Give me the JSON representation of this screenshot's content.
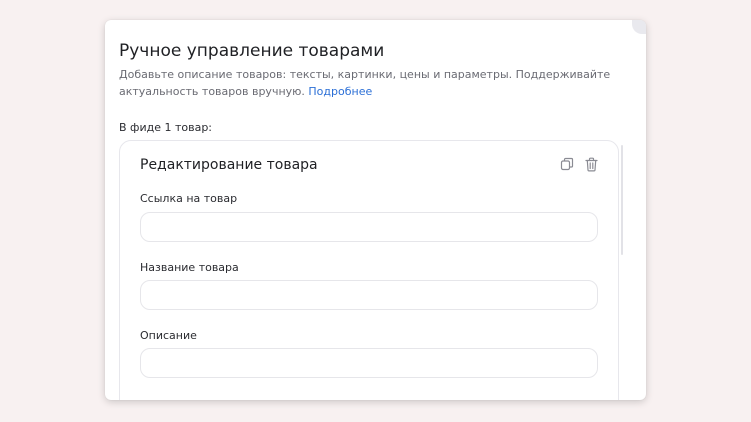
{
  "modal": {
    "title": "Ручное управление товарами",
    "description": "Добавьте описание товаров: тексты, картинки, цены и параметры. Поддерживайте актуальность товаров вручную.",
    "link_label": "Подробнее",
    "feed_count": "В фиде 1 товар:"
  },
  "card": {
    "title": "Редактирование товара",
    "icons": {
      "copy": "copy-icon",
      "delete": "trash-icon"
    },
    "fields": [
      {
        "label": "Ссылка на товар",
        "value": "",
        "placeholder": ""
      },
      {
        "label": "Название товара",
        "value": "",
        "placeholder": ""
      },
      {
        "label": "Описание",
        "value": "",
        "placeholder": ""
      }
    ]
  },
  "colors": {
    "page_bg": "#f8f1f1",
    "link": "#2b6fd6",
    "text": "#1f2024",
    "muted": "#6a6b73",
    "border": "#e6e6ea"
  }
}
